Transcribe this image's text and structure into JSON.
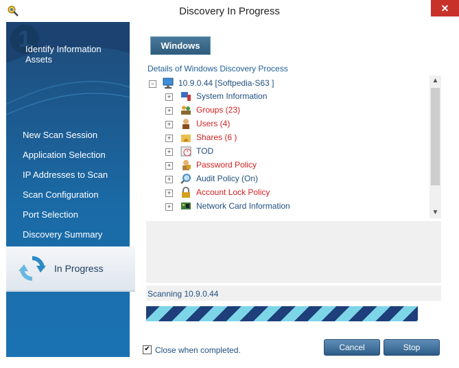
{
  "window": {
    "title": "Discovery In Progress",
    "close_label": "✕"
  },
  "sidebar": {
    "step_number": "1",
    "heading": "Identify Information Assets",
    "items": [
      {
        "label": "New Scan Session"
      },
      {
        "label": "Application Selection"
      },
      {
        "label": "IP Addresses to Scan"
      },
      {
        "label": "Scan Configuration"
      },
      {
        "label": "Port Selection"
      },
      {
        "label": "Discovery Summary"
      }
    ],
    "active_label": "In Progress"
  },
  "main": {
    "tab_label": "Windows",
    "details_label": "Details of Windows Discovery Process",
    "tree": {
      "root_label": "10.9.0.44 [Softpedia-S63 ]",
      "nodes": [
        {
          "label": "System Information",
          "color": "#1f4f7f",
          "icon": "computer-icon"
        },
        {
          "label": "Groups (23)",
          "color": "#d42020",
          "icon": "group-icon"
        },
        {
          "label": "Users (4)",
          "color": "#d42020",
          "icon": "user-icon"
        },
        {
          "label": "Shares (6 )",
          "color": "#d42020",
          "icon": "share-icon"
        },
        {
          "label": "TOD",
          "color": "#1f4f7f",
          "icon": "clock-icon"
        },
        {
          "label": "Password Policy",
          "color": "#d42020",
          "icon": "password-icon"
        },
        {
          "label": "Audit Policy  (On)",
          "color": "#1f4f7f",
          "icon": "audit-icon"
        },
        {
          "label": "Account Lock Policy",
          "color": "#d42020",
          "icon": "lock-icon"
        },
        {
          "label": "Network Card Information",
          "color": "#1f4f7f",
          "icon": "network-card-icon"
        }
      ]
    },
    "status_text": "Scanning 10.9.0.44",
    "progress_style": "indeterminate",
    "close_when_completed": {
      "checked": true,
      "label": "Close when completed."
    },
    "buttons": {
      "cancel": "Cancel",
      "stop": "Stop"
    }
  },
  "colors": {
    "sidebar": "#1a6aa6",
    "accent": "#1f4f7f",
    "highlight_red": "#d42020",
    "progress_dark": "#1e3f7a",
    "progress_light": "#7dd5e8"
  }
}
